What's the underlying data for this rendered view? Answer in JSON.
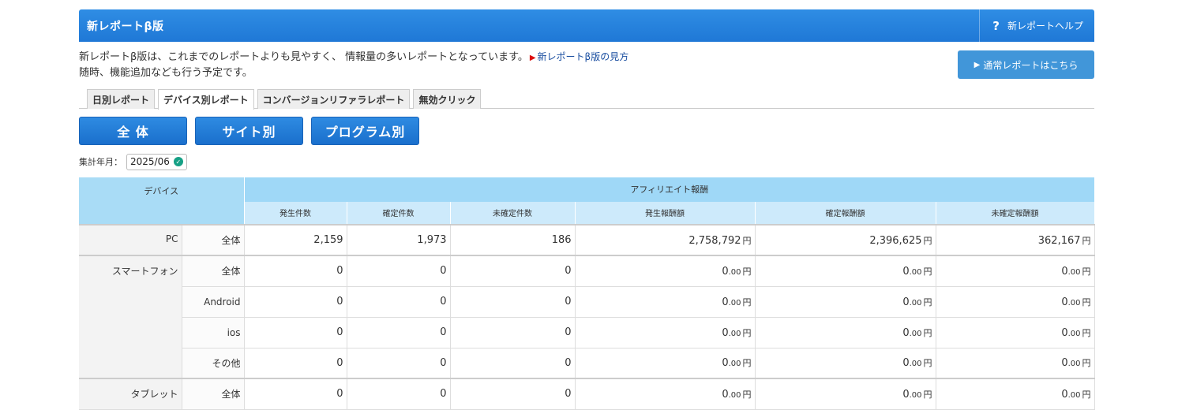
{
  "header": {
    "title": "新レポートβ版",
    "help_icon": "?",
    "help_label": "新レポートヘルプ"
  },
  "intro": {
    "line1": "新レポートβ版は、これまでのレポートよりも見やすく、 情報量の多いレポートとなっています。",
    "link_label": "新レポートβ版の見方",
    "line2": "随時、機能追加なども行う予定です。",
    "normal_button": "通常レポートはこちら"
  },
  "tabs": [
    {
      "label": "日別レポート"
    },
    {
      "label": "デバイス別レポート"
    },
    {
      "label": "コンバージョンリファラレポート"
    },
    {
      "label": "無効クリック"
    }
  ],
  "segments": [
    {
      "label": "全 体"
    },
    {
      "label": "サイト別"
    },
    {
      "label": "プログラム別"
    }
  ],
  "period": {
    "label": "集計年月：",
    "value": "2025/06"
  },
  "table": {
    "device_header": "デバイス",
    "group_header": "アフィリエイト報酬",
    "columns": [
      "発生件数",
      "確定件数",
      "未確定件数",
      "発生報酬額",
      "確定報酬額",
      "未確定報酬額"
    ],
    "yen": "円",
    "rows": [
      {
        "device": "PC",
        "sub": "全体",
        "c1": "2,159",
        "c2": "1,973",
        "c3": "186",
        "a1": "2,758,792",
        "a1d": "",
        "a2": "2,396,625",
        "a2d": "",
        "a3": "362,167",
        "a3d": ""
      },
      {
        "device": "スマートフォン",
        "sub": "全体",
        "c1": "0",
        "c2": "0",
        "c3": "0",
        "a1": "0",
        "a1d": ".00",
        "a2": "0",
        "a2d": ".00",
        "a3": "0",
        "a3d": ".00"
      },
      {
        "device": "",
        "sub": "Android",
        "c1": "0",
        "c2": "0",
        "c3": "0",
        "a1": "0",
        "a1d": ".00",
        "a2": "0",
        "a2d": ".00",
        "a3": "0",
        "a3d": ".00"
      },
      {
        "device": "",
        "sub": "ios",
        "c1": "0",
        "c2": "0",
        "c3": "0",
        "a1": "0",
        "a1d": ".00",
        "a2": "0",
        "a2d": ".00",
        "a3": "0",
        "a3d": ".00"
      },
      {
        "device": "",
        "sub": "その他",
        "c1": "0",
        "c2": "0",
        "c3": "0",
        "a1": "0",
        "a1d": ".00",
        "a2": "0",
        "a2d": ".00",
        "a3": "0",
        "a3d": ".00"
      },
      {
        "device": "タブレット",
        "sub": "全体",
        "c1": "0",
        "c2": "0",
        "c3": "0",
        "a1": "0",
        "a1d": ".00",
        "a2": "0",
        "a2d": ".00",
        "a3": "0",
        "a3d": ".00"
      }
    ]
  }
}
